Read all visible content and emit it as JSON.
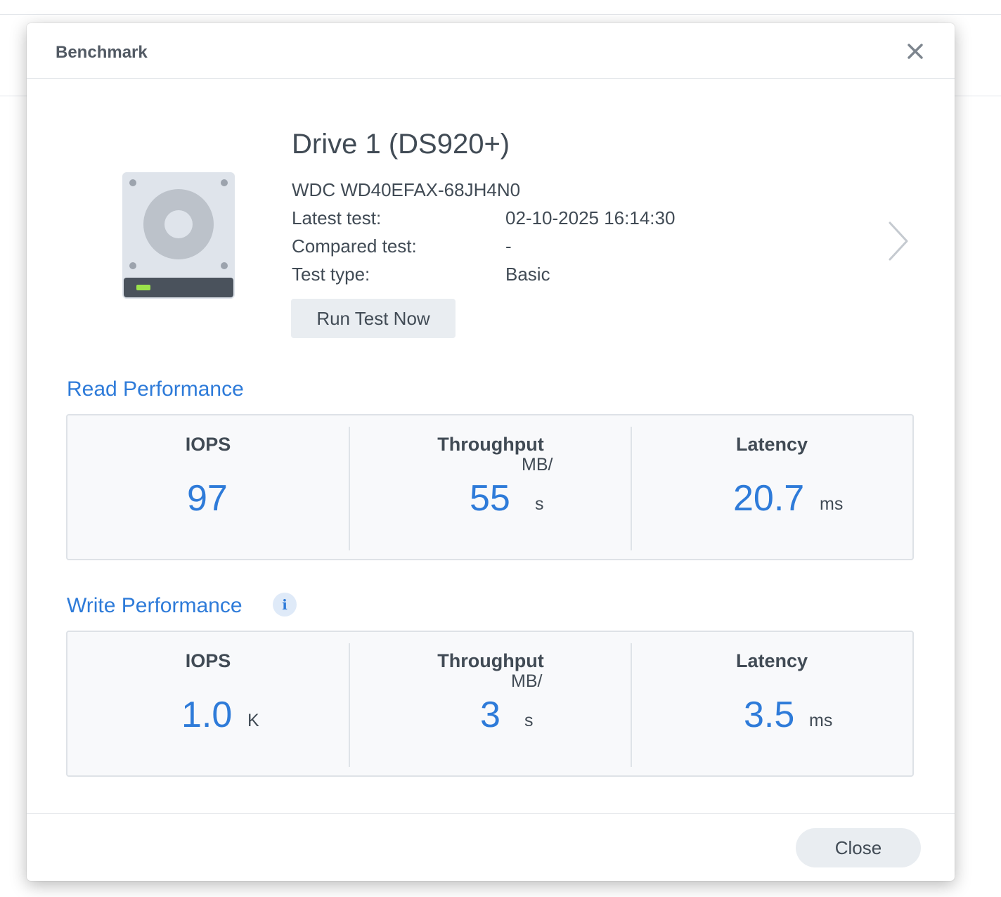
{
  "dialog": {
    "title": "Benchmark",
    "close_icon": "close-icon"
  },
  "drive": {
    "name": "Drive 1 (DS920+)",
    "model": "WDC WD40EFAX-68JH4N0",
    "icon": "hard-drive-icon",
    "led_color": "#9be34b",
    "fields": [
      {
        "label": "Latest test:",
        "value": "02-10-2025 16:14:30"
      },
      {
        "label": "Compared test:",
        "value": "-"
      },
      {
        "label": "Test type:",
        "value": "Basic"
      }
    ],
    "run_button_label": "Run Test Now",
    "next_icon": "chevron-right-icon"
  },
  "read": {
    "title": "Read Performance",
    "metrics": [
      {
        "label": "IOPS",
        "value": "97",
        "unit": ""
      },
      {
        "label": "Throughput",
        "value": "55",
        "unit_top": "MB/",
        "unit_bottom": "s"
      },
      {
        "label": "Latency",
        "value": "20.7",
        "unit": "ms"
      }
    ]
  },
  "write": {
    "title": "Write Performance",
    "info_icon": "info-icon",
    "info_glyph": "i",
    "metrics": [
      {
        "label": "IOPS",
        "value": "1.0",
        "unit": "K"
      },
      {
        "label": "Throughput",
        "value": "3",
        "unit_top": "MB/",
        "unit_bottom": "s"
      },
      {
        "label": "Latency",
        "value": "3.5",
        "unit": "ms"
      }
    ]
  },
  "footer": {
    "close_label": "Close"
  },
  "colors": {
    "accent": "#2e7bd9",
    "text": "#414b55",
    "panel_bg": "#f8f9fb",
    "button_bg": "#e9edf1"
  }
}
